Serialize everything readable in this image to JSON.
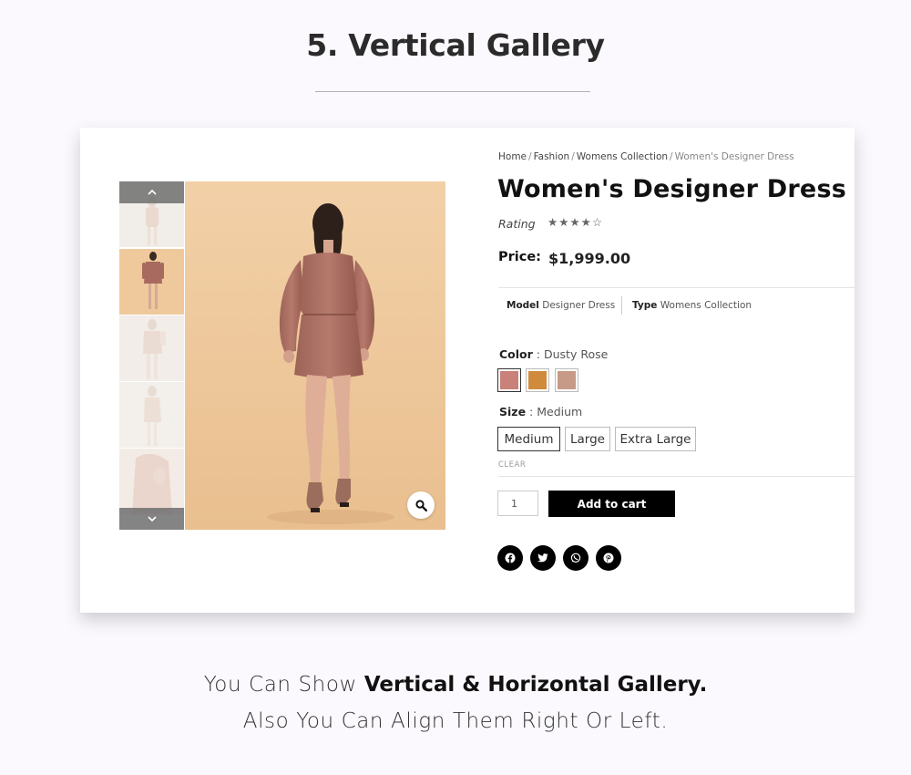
{
  "page": {
    "title": "5. Vertical Gallery"
  },
  "breadcrumb": {
    "items": [
      "Home",
      "Fashion",
      "Womens Collection"
    ],
    "separator": "/",
    "current": "Women's Designer Dress"
  },
  "product": {
    "title": "Women's Designer Dress",
    "rating_label": "Rating",
    "rating_stars": "★★★★☆",
    "rating_value": 4,
    "rating_max": 5,
    "price_label": "Price:",
    "price_value": "$1,999.00",
    "meta": {
      "model_label": "Model",
      "model_value": "Designer Dress",
      "type_label": "Type",
      "type_value": "Womens Collection"
    },
    "color": {
      "label": "Color",
      "separator": " : ",
      "selected": "Dusty Rose",
      "swatches": [
        "#c9817a",
        "#d08a3c",
        "#c79a88"
      ]
    },
    "size": {
      "label": "Size",
      "separator": " : ",
      "selected": "Medium",
      "options": [
        "Medium",
        "Large",
        "Extra Large"
      ]
    },
    "clear_label": "CLEAR",
    "quantity": "1",
    "add_to_cart": "Add to cart"
  },
  "gallery": {
    "thumbnails": 5,
    "selected_index": 1,
    "up_icon": "chevron-up-icon",
    "down_icon": "chevron-down-icon",
    "zoom_icon": "magnifier-icon"
  },
  "share": [
    "facebook-icon",
    "twitter-icon",
    "whatsapp-icon",
    "pinterest-icon"
  ],
  "caption": {
    "line1_plain": "You Can Show ",
    "line1_bold": "Vertical & Horizontal Gallery.",
    "line2": "Also You Can Align Them Right Or Left."
  }
}
